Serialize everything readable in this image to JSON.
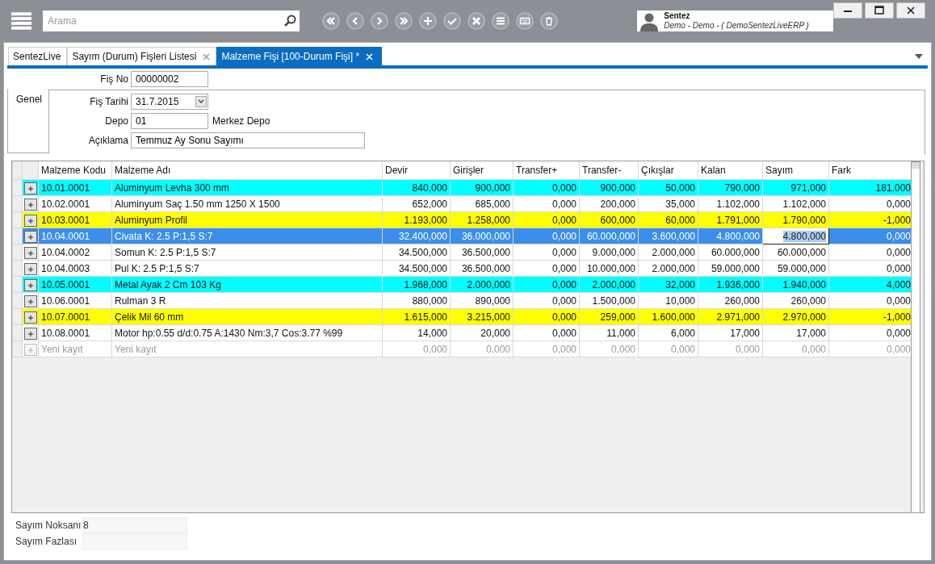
{
  "toolbar": {
    "search": {
      "placeholder": "Arama"
    },
    "user": {
      "name": "Sentez",
      "detail": "Demo - Demo - ( DemoSentezLiveERP )"
    }
  },
  "tabs": [
    {
      "label": "SentezLive",
      "selected": false,
      "closable": false
    },
    {
      "label": "Sayım (Durum) Fişleri Listesi",
      "selected": false,
      "closable": true
    },
    {
      "label": "Malzeme Fişi  [100-Durum Fişi] *",
      "selected": true,
      "closable": true
    }
  ],
  "form": {
    "fis_no": {
      "label": "Fiş No",
      "value": "00000002"
    },
    "side_tab": "Genel",
    "fis_tarihi": {
      "label": "Fiş Tarihi",
      "value": "31.7.2015"
    },
    "depo": {
      "label": "Depo",
      "value": "01",
      "name": "Merkez Depo"
    },
    "aciklama": {
      "label": "Açıklama",
      "value": "Temmuz Ay Sonu Sayımı"
    }
  },
  "table": {
    "columns": [
      {
        "label": "Malzeme Kodu",
        "kind": "text"
      },
      {
        "label": "Malzeme Adı",
        "kind": "text"
      },
      {
        "label": "Devir",
        "kind": "number"
      },
      {
        "label": "Girişler",
        "kind": "number"
      },
      {
        "label": "Transfer+",
        "kind": "number"
      },
      {
        "label": "Transfer-",
        "kind": "number"
      },
      {
        "label": "Çıkışlar",
        "kind": "number"
      },
      {
        "label": "Kalan",
        "kind": "number"
      },
      {
        "label": "Sayım",
        "kind": "number"
      },
      {
        "label": "Fark",
        "kind": "number"
      }
    ],
    "rows": [
      {
        "kind": "item",
        "color": "#00ffff",
        "selected": false,
        "cells": [
          "10.01.0001",
          "Aluminyum Levha 300 mm",
          "840,000",
          "900,000",
          "0,000",
          "900,000",
          "50,000",
          "790,000",
          "971,000",
          "181,000"
        ]
      },
      {
        "kind": "item",
        "color": "#ffffff",
        "selected": false,
        "cells": [
          "10.02.0001",
          "Aluminyum Saç 1.50 mm 1250 X 1500",
          "652,000",
          "685,000",
          "0,000",
          "200,000",
          "35,000",
          "1.102,000",
          "1.102,000",
          "0,000"
        ]
      },
      {
        "kind": "item",
        "color": "#ffff00",
        "selected": false,
        "cells": [
          "10.03.0001",
          "Aluminyum Profil",
          "1.193,000",
          "1.258,000",
          "0,000",
          "600,000",
          "60,000",
          "1.791,000",
          "1.790,000",
          "-1,000"
        ]
      },
      {
        "kind": "item",
        "selected": true,
        "cells": [
          "10.04.0001",
          "Civata K: 2.5 P:1,5 S:7",
          "32.400,000",
          "36.000,000",
          "0,000",
          "60.000,000",
          "3.600,000",
          "4.800,000",
          {
            "text": "4.800,000",
            "editing": true
          },
          "0,000"
        ]
      },
      {
        "kind": "item",
        "color": "#ffffff",
        "selected": false,
        "cells": [
          "10.04.0002",
          "Somun K: 2.5 P:1,5 S:7",
          "34.500,000",
          "36.500,000",
          "0,000",
          "9.000,000",
          "2.000,000",
          "60.000,000",
          "60.000,000",
          "0,000"
        ]
      },
      {
        "kind": "item",
        "color": "#ffffff",
        "selected": false,
        "cells": [
          "10.04.0003",
          "Pul K: 2.5 P:1,5 S:7",
          "34.500,000",
          "36.500,000",
          "0,000",
          "10.000,000",
          "2.000,000",
          "59.000,000",
          "59.000,000",
          "0,000"
        ]
      },
      {
        "kind": "item",
        "color": "#00ffff",
        "selected": false,
        "cells": [
          "10.05.0001",
          "Metal Ayak 2 Cm 103 Kg",
          "1.968,000",
          "2.000,000",
          "0,000",
          "2.000,000",
          "32,000",
          "1.936,000",
          "1.940,000",
          "4,000"
        ]
      },
      {
        "kind": "item",
        "color": "#ffffff",
        "selected": false,
        "cells": [
          "10.06.0001",
          "Rulman 3 R",
          "880,000",
          "890,000",
          "0,000",
          "1.500,000",
          "10,000",
          "260,000",
          "260,000",
          "0,000"
        ]
      },
      {
        "kind": "item",
        "color": "#ffff00",
        "selected": false,
        "cells": [
          "10.07.0001",
          "Çelik Mil 60 mm",
          "1.615,000",
          "3.215,000",
          "0,000",
          "259,000",
          "1.600,000",
          "2.971,000",
          "2.970,000",
          "-1,000"
        ]
      },
      {
        "kind": "item",
        "color": "#ffffff",
        "selected": false,
        "cells": [
          "10.08.0001",
          "Motor hp:0.55 d/d:0.75 A:1430 Nm:3,7 Cos:3.77 %99",
          "14,000",
          "20,000",
          "0,000",
          "11,000",
          "6,000",
          "17,000",
          "17,000",
          "0,000"
        ]
      },
      {
        "kind": "new",
        "color": "#ffffff",
        "selected": false,
        "cells": [
          "Yeni kayıt",
          "Yeni kayıt",
          "0,000",
          "0,000",
          "0,000",
          "0,000",
          "0,000",
          "0,000",
          "0,000",
          "0,000"
        ]
      }
    ]
  },
  "summary": [
    {
      "label": "Sayım Noksanı",
      "value": "8"
    },
    {
      "label": "Sayım Fazlası"
    }
  ]
}
